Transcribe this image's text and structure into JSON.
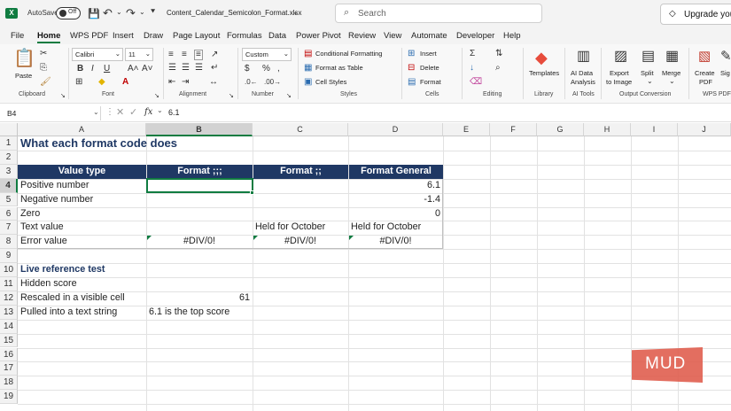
{
  "titlebar": {
    "autosave_label": "AutoSave",
    "autosave_state": "Off",
    "filename": "Content_Calendar_Semicolon_Format.xlsx",
    "search_placeholder": "Search",
    "upgrade_label": "Upgrade your"
  },
  "menu": [
    "File",
    "Home",
    "WPS PDF",
    "Insert",
    "Draw",
    "Page Layout",
    "Formulas",
    "Data",
    "Power Pivot",
    "Review",
    "View",
    "Automate",
    "Developer",
    "Help"
  ],
  "menu_active": "Home",
  "ribbon": {
    "paste_label": "Paste",
    "clipboard_label": "Clipboard",
    "font_name": "Calibri",
    "font_size": "11",
    "font_label": "Font",
    "alignment_label": "Alignment",
    "number_format": "Custom",
    "number_label": "Number",
    "conditional_formatting": "Conditional Formatting",
    "format_as_table": "Format as Table",
    "cell_styles": "Cell Styles",
    "styles_label": "Styles",
    "insert_label": "Insert",
    "delete_label": "Delete",
    "format_label": "Format",
    "cells_label": "Cells",
    "editing_label": "Editing",
    "templates_label": "Templates",
    "library_label": "Library",
    "ai_data_line1": "AI Data",
    "ai_data_line2": "Analysis",
    "ai_tools_label": "AI Tools",
    "export_line1": "Export",
    "export_line2": "to Image",
    "split_label": "Split",
    "merge_label": "Merge",
    "output_conversion_label": "Output Conversion",
    "create_line1": "Create",
    "create_line2": "PDF",
    "sign_label": "Sig",
    "wps_pdf_label": "WPS PDF"
  },
  "formula_bar": {
    "name_box": "B4",
    "fx_label": "fx",
    "content": "6.1"
  },
  "columns": [
    "A",
    "B",
    "C",
    "D",
    "E",
    "F",
    "G",
    "H",
    "I",
    "J"
  ],
  "rows": [
    "1",
    "2",
    "3",
    "4",
    "5",
    "6",
    "7",
    "8",
    "9",
    "10",
    "11",
    "12",
    "13",
    "14",
    "15",
    "16",
    "17",
    "18",
    "19"
  ],
  "sheet": {
    "A1": "What each format code does",
    "A3": "Value type",
    "B3": "Format ;;;",
    "C3": "Format ;;",
    "D3": "Format General",
    "A4": "Positive number",
    "D4": "6.1",
    "A5": "Negative number",
    "D5": "-1.4",
    "A6": "Zero",
    "D6": "0",
    "A7": "Text value",
    "C7": "Held for October",
    "D7": "Held for October",
    "A8": "Error value",
    "B8": "#DIV/0!",
    "C8": "#DIV/0!",
    "D8": "#DIV/0!",
    "A10": "Live reference test",
    "A11": "Hidden score",
    "A12": "Rescaled in a visible cell",
    "B12": "61",
    "A13": "Pulled into a text string",
    "B13": "6.1 is the top score"
  },
  "watermark": "MUD",
  "colors": {
    "header_fill": "#1f3864",
    "title_text": "#1f3864",
    "accent_green": "#107c41",
    "watermark": "#e05a4a"
  }
}
